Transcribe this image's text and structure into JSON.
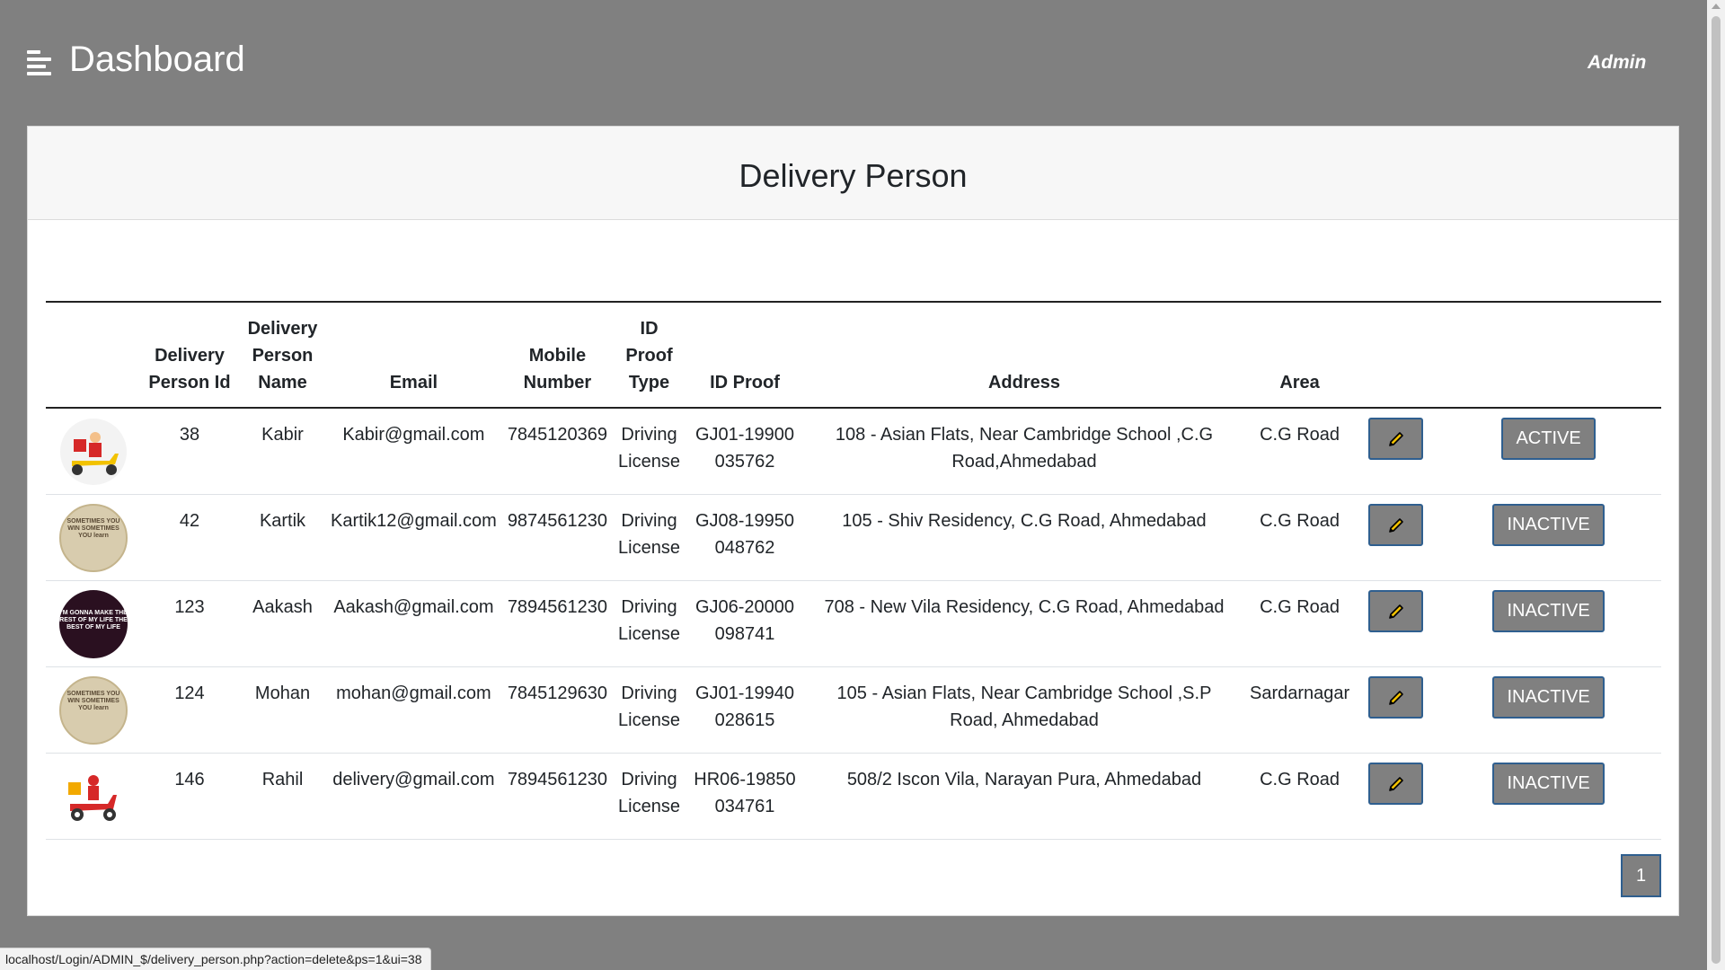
{
  "header": {
    "title": "Dashboard",
    "user": "Admin"
  },
  "card": {
    "title": "Delivery Person"
  },
  "table": {
    "columns": [
      "",
      "Delivery Person Id",
      "Delivery Person Name",
      "Email",
      "Mobile Number",
      "ID Proof Type",
      "ID Proof",
      "Address",
      "Area",
      "",
      ""
    ],
    "rows": [
      {
        "id": "38",
        "name": "Kabir",
        "email": "Kabir@gmail.com",
        "mobile": "7845120369",
        "proof_type": "Driving License",
        "proof": "GJ01-19900035762",
        "address": "108 - Asian Flats, Near Cambridge School ,C.G Road,Ahmedabad",
        "area": "C.G Road",
        "status": "ACTIVE",
        "avatar": "scooter-delivery-icon"
      },
      {
        "id": "42",
        "name": "Kartik",
        "email": "Kartik12@gmail.com",
        "mobile": "9874561230",
        "proof_type": "Driving License",
        "proof": "GJ08-19950048762",
        "address": "105 - Shiv Residency, C.G Road, Ahmedabad",
        "area": "C.G Road",
        "status": "INACTIVE",
        "avatar": "quote-badge-image"
      },
      {
        "id": "123",
        "name": "Aakash",
        "email": "Aakash@gmail.com",
        "mobile": "7894561230",
        "proof_type": "Driving License",
        "proof": "GJ06-20000098741",
        "address": "708 - New Vila Residency, C.G Road, Ahmedabad",
        "area": "C.G Road",
        "status": "INACTIVE",
        "avatar": "dark-quote-image"
      },
      {
        "id": "124",
        "name": "Mohan",
        "email": "mohan@gmail.com",
        "mobile": "7845129630",
        "proof_type": "Driving License",
        "proof": "GJ01-19940028615",
        "address": "105 - Asian Flats, Near Cambridge School ,S.P Road, Ahmedabad",
        "area": "Sardarnagar",
        "status": "INACTIVE",
        "avatar": "quote-badge-image"
      },
      {
        "id": "146",
        "name": "Rahil",
        "email": "delivery@gmail.com",
        "mobile": "7894561230",
        "proof_type": "Driving License",
        "proof": "HR06-19850034761",
        "address": "508/2 Iscon Vila, Narayan Pura, Ahmedabad",
        "area": "C.G Road",
        "status": "INACTIVE",
        "avatar": "red-scooter-icon"
      }
    ]
  },
  "avatar_text": {
    "quote": "SOMETIMES YOU WIN SOMETIMES YOU learn",
    "dark": "I'M GONNA MAKE THE REST OF MY LIFE THE BEST OF MY LIFE"
  },
  "pagination": {
    "current": "1"
  },
  "status_bar": {
    "url": "localhost/Login/ADMIN_$/delivery_person.php?action=delete&ps=1&ui=38"
  },
  "colors": {
    "background": "#808080",
    "button": "#808080",
    "button_border": "#2f5f8f",
    "pencil": "#f2c200"
  }
}
